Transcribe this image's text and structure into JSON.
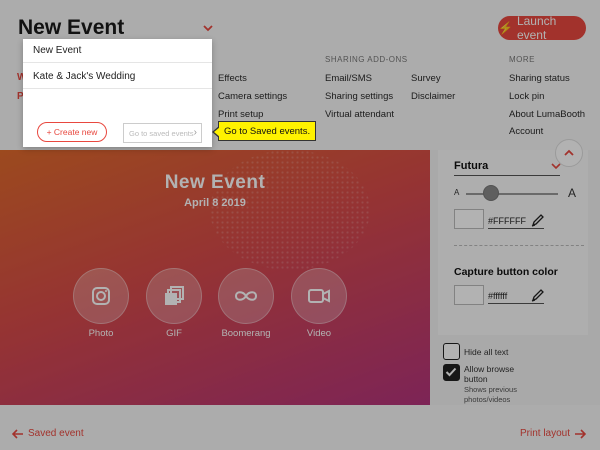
{
  "header": {
    "event_title": "New Event",
    "launch_label": "Launch event",
    "launch_icon": "lightning-bolt-icon"
  },
  "menu": {
    "partial_w": "W",
    "partial_p": "P",
    "col1": [
      "Effects",
      "Camera settings",
      "Print setup"
    ],
    "sharing_heading": "SHARING ADD-ONS",
    "col2": [
      "Email/SMS",
      "Sharing settings",
      "Virtual attendant"
    ],
    "col3": [
      "Survey",
      "Disclaimer"
    ],
    "more_heading": "MORE",
    "col4": [
      "Sharing status",
      "Lock pin",
      "About LumaBooth",
      "Account"
    ]
  },
  "dropdown": {
    "items": [
      "New Event",
      "Kate & Jack's Wedding"
    ],
    "create_label": "+ Create new",
    "saved_label": "Go to saved events"
  },
  "tooltip": {
    "text": "Go to Saved events."
  },
  "canvas": {
    "title": "New Event",
    "date": "April 8 2019",
    "modes": [
      {
        "label": "Photo",
        "icon": "camera-icon"
      },
      {
        "label": "GIF",
        "icon": "stacked-frames-icon"
      },
      {
        "label": "Boomerang",
        "icon": "infinity-icon"
      },
      {
        "label": "Video",
        "icon": "video-camera-icon"
      }
    ]
  },
  "panel": {
    "font_name": "Futura",
    "size_small": "A",
    "size_large": "A",
    "text_color_hex": "#FFFFFF",
    "capture_label": "Capture button color",
    "capture_color_hex": "#ffffff"
  },
  "options": {
    "hide_all_text": "Hide all text",
    "hide_all_text_checked": false,
    "allow_browse": "Allow browse",
    "allow_browse_2": "button",
    "allow_browse_checked": true,
    "allow_browse_sub1": "Shows previous",
    "allow_browse_sub2": "photos/videos"
  },
  "footer": {
    "back_label": "Saved event",
    "next_label": "Print layout"
  },
  "colors": {
    "accent": "#e8483f",
    "tooltip": "#fff200"
  }
}
